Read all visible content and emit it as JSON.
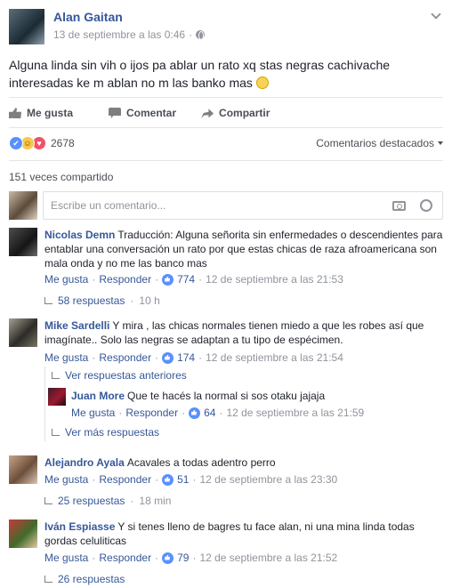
{
  "post": {
    "author": "Alan Gaitan",
    "timestamp": "13 de septiembre a las 0:46",
    "separator": "·",
    "text": "Alguna linda sin vih o ijos pa ablar un rato xq stas negras cachivache interesadas ke m ablan no m las banko mas"
  },
  "actions": {
    "like": "Me gusta",
    "comment": "Comentar",
    "share": "Compartir"
  },
  "reactions": {
    "count": "2678",
    "types": [
      "like",
      "haha",
      "love"
    ],
    "sort_label": "Comentarios destacados"
  },
  "shares": "151 veces compartido",
  "comment_input": {
    "placeholder": "Escribe un comentario..."
  },
  "comments": [
    {
      "author": "Nicolas Demn",
      "text": "Traducción: Alguna señorita sin enfermedades o descendientes para entablar una conversación un rato por que estas chicas de raza afroamericana son mala onda y no me las banco mas",
      "like": "Me gusta",
      "reply": "Responder",
      "likes": "774",
      "time": "12 de septiembre a las 21:53",
      "replies": "58 respuestas",
      "replies_time": "10 h"
    },
    {
      "author": "Mike Sardelli",
      "text": "Y mira , las chicas normales tienen miedo a que les robes así que imagínate.. Solo las negras se adaptan a tu tipo de espécimen.",
      "like": "Me gusta",
      "reply": "Responder",
      "likes": "174",
      "time": "12 de septiembre a las 21:54",
      "prev_replies": "Ver respuestas anteriores",
      "more_replies": "Ver más respuestas",
      "nested": {
        "author": "Juan More",
        "text": "Que te hacés la normal si sos otaku jajaja",
        "like": "Me gusta",
        "reply": "Responder",
        "likes": "64",
        "time": "12 de septiembre a las 21:59"
      }
    },
    {
      "author": "Alejandro Ayala",
      "text": "Acavales a todas adentro perro",
      "like": "Me gusta",
      "reply": "Responder",
      "likes": "51",
      "time": "12 de septiembre a las 23:30",
      "replies": "25 respuestas",
      "replies_time": "18 min"
    },
    {
      "author": "Iván Espiasse",
      "text": "Y si tenes lleno de bagres tu face alan, ni una mina linda todas gordas celuliticas",
      "like": "Me gusta",
      "reply": "Responder",
      "likes": "79",
      "time": "12 de septiembre a las 21:52",
      "replies": "26 respuestas"
    }
  ]
}
